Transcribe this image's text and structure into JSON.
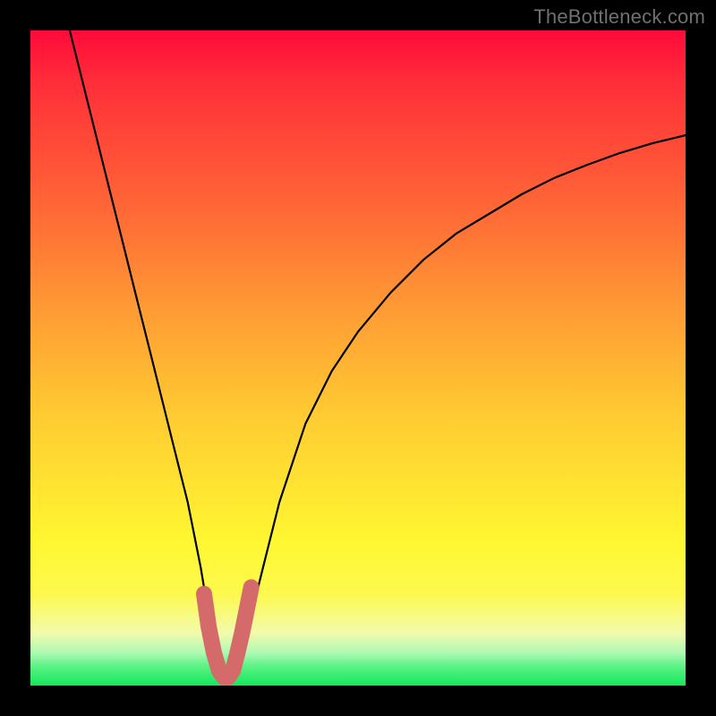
{
  "watermark": "TheBottleneck.com",
  "chart_data": {
    "type": "line",
    "title": "",
    "xlabel": "",
    "ylabel": "",
    "xlim": [
      0,
      100
    ],
    "ylim": [
      0,
      100
    ],
    "grid": false,
    "legend": false,
    "series": [
      {
        "name": "bottleneck-curve",
        "x": [
          6,
          8,
          10,
          12,
          14,
          16,
          18,
          20,
          22,
          24,
          26,
          27,
          28,
          29,
          30,
          31,
          32,
          33,
          34,
          36,
          38,
          42,
          46,
          50,
          55,
          60,
          65,
          70,
          75,
          80,
          85,
          90,
          95,
          100
        ],
        "values": [
          100,
          92,
          84,
          76,
          68,
          60,
          52,
          44,
          36,
          28,
          18,
          12,
          7,
          3,
          1,
          1,
          3,
          7,
          12,
          20,
          28,
          40,
          48,
          54,
          60,
          65,
          69,
          72,
          75,
          77.5,
          79.5,
          81.3,
          82.8,
          84
        ]
      }
    ],
    "highlight": {
      "name": "minimum-band",
      "x": [
        26.5,
        27.2,
        28.0,
        28.8,
        29.5,
        30.2,
        30.9,
        31.6,
        32.3,
        33.0,
        33.7
      ],
      "values": [
        14.0,
        9.0,
        5.0,
        2.3,
        1.3,
        1.3,
        2.3,
        5.0,
        8.0,
        11.5,
        15.0
      ]
    },
    "background_gradient": {
      "stops": [
        {
          "pos": 0.0,
          "color": "#ff0a3a"
        },
        {
          "pos": 0.28,
          "color": "#ff6a36"
        },
        {
          "pos": 0.58,
          "color": "#ffc932"
        },
        {
          "pos": 0.86,
          "color": "#fdf94e"
        },
        {
          "pos": 0.97,
          "color": "#5df286"
        },
        {
          "pos": 1.0,
          "color": "#12e85b"
        }
      ]
    }
  }
}
